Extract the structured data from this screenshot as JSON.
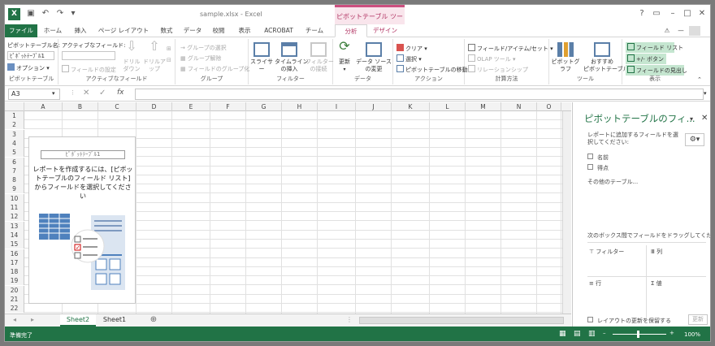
{
  "window": {
    "title": "sample.xlsx - Excel",
    "context_title": "ピボットテーブル ツール",
    "user": "—"
  },
  "tabs": [
    "ファイル",
    "ホーム",
    "挿入",
    "ページ レイアウト",
    "数式",
    "データ",
    "校閲",
    "表示",
    "ACROBAT",
    "チーム",
    "分析",
    "デザイン"
  ],
  "ribbon": {
    "pivot_name_label": "ピボットテーブル名:",
    "pivot_name_value": "ﾋﾟﾎﾞｯﾄﾃｰﾌﾞﾙ1",
    "options": "オプション",
    "g_pivot": "ピボットテーブル",
    "active_field_label": "アクティブなフィールド:",
    "field_settings": "フィールドの設定",
    "drill_down": "ドリル\nダウン",
    "drill_up": "ドリルア\nップ",
    "g_active": "アクティブなフィールド",
    "group_selection": "グループの選択",
    "ungroup": "グループ解除",
    "group_field": "フィールドのグループ化",
    "g_group": "グループ",
    "slicer": "スライサー",
    "timeline": "タイムライン\nの挿入",
    "filter_conn": "フィルター\nの接続",
    "g_filter": "フィルター",
    "refresh": "更新",
    "change_source": "データ ソース\nの変更",
    "g_data": "データ",
    "clear": "クリア",
    "select": "選択",
    "move_pivot": "ピボットテーブルの移動",
    "g_action": "アクション",
    "fields_items": "フィールド/アイテム/セット",
    "olap": "OLAP ツール",
    "relations": "リレーションシップ",
    "g_calc": "計算方法",
    "pivot_chart": "ピボットグラフ",
    "recommended": "おすすめ\nピボットテーブル",
    "g_tools": "ツール",
    "field_list": "フィールド リスト",
    "buttons": "+/- ボタン",
    "field_headers": "フィールドの見出し",
    "g_show": "表示"
  },
  "formula": {
    "name_box": "A3",
    "fx": "fx",
    "content": ""
  },
  "columns": [
    "A",
    "B",
    "C",
    "D",
    "E",
    "F",
    "G",
    "H",
    "I",
    "J",
    "K",
    "L",
    "M",
    "N",
    "O"
  ],
  "rows": [
    "1",
    "2",
    "3",
    "4",
    "5",
    "6",
    "7",
    "8",
    "9",
    "10",
    "11",
    "12",
    "13",
    "14",
    "15",
    "16",
    "17",
    "18",
    "19",
    "20",
    "21",
    "22"
  ],
  "pivot_placeholder": {
    "name": "ﾋﾟﾎﾞｯﾄﾃｰﾌﾞﾙ1",
    "message": "レポートを作成するには、[ピボットテーブルのフィールド リスト] からフィールドを選択してください"
  },
  "sheets": [
    "Sheet2",
    "Sheet1"
  ],
  "pane": {
    "title": "ピボットテーブルのフィ...",
    "subtitle": "レポートに追加するフィールドを選択してください:",
    "fields": [
      "名前",
      "得点"
    ],
    "more_tables": "その他のテーブル...",
    "drag_hint": "次のボックス間でフィールドをドラッグしてください:",
    "area_filter": "フィルター",
    "area_cols": "列",
    "area_rows": "行",
    "area_values": "値",
    "defer_label": "レイアウトの更新を保留する",
    "update_button": "更新"
  },
  "status": {
    "ready": "準備完了",
    "zoom": "100%"
  },
  "colors": {
    "excel_green": "#217346",
    "context_pink": "#b03060",
    "highlight": "#c5e6d0"
  }
}
